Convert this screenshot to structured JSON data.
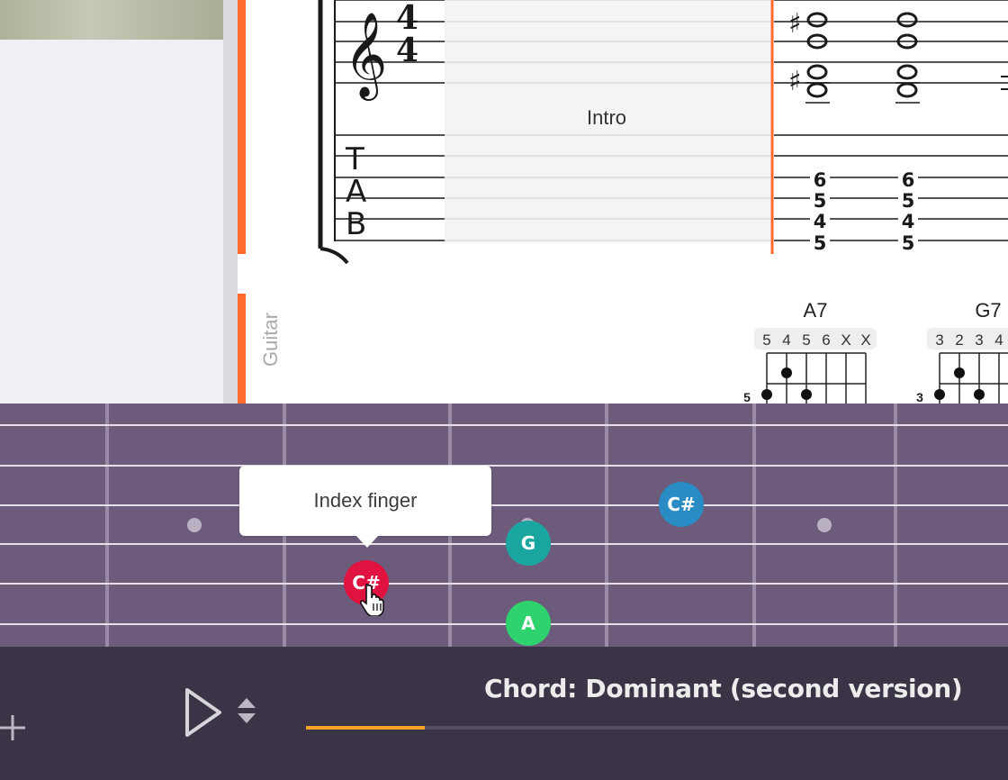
{
  "sheet": {
    "section_label": "Intro",
    "track_name": "Guitar",
    "time_signature": {
      "top": "4",
      "bottom": "4"
    },
    "tab_clef": [
      "T",
      "A",
      "B"
    ],
    "tab_columns": [
      {
        "frets": [
          "6",
          "5",
          "4",
          "5"
        ]
      },
      {
        "frets": [
          "6",
          "5",
          "4",
          "5"
        ]
      }
    ],
    "chord_diagrams": [
      {
        "name": "A7",
        "fingering": [
          "5",
          "4",
          "5",
          "6",
          "X",
          "X"
        ],
        "fret_number": "5"
      },
      {
        "name": "G7",
        "fingering": [
          "3",
          "2",
          "3",
          "4"
        ],
        "fret_number": "3"
      }
    ]
  },
  "fretboard": {
    "notes": [
      {
        "label": "C#",
        "color": "#2a8cc4"
      },
      {
        "label": "G",
        "color": "#1aa6a0"
      },
      {
        "label": "C#",
        "color": "#e0123f"
      },
      {
        "label": "A",
        "color": "#2fd36d"
      }
    ],
    "tooltip": "Index finger"
  },
  "player": {
    "chord_title": "Chord: Dominant (second version)",
    "progress": 0.17,
    "colors": {
      "progress": "#f4a428",
      "accent": "#ff6b2b"
    },
    "icons": [
      "plus-icon",
      "play-icon",
      "speed-arrows-icon"
    ]
  }
}
